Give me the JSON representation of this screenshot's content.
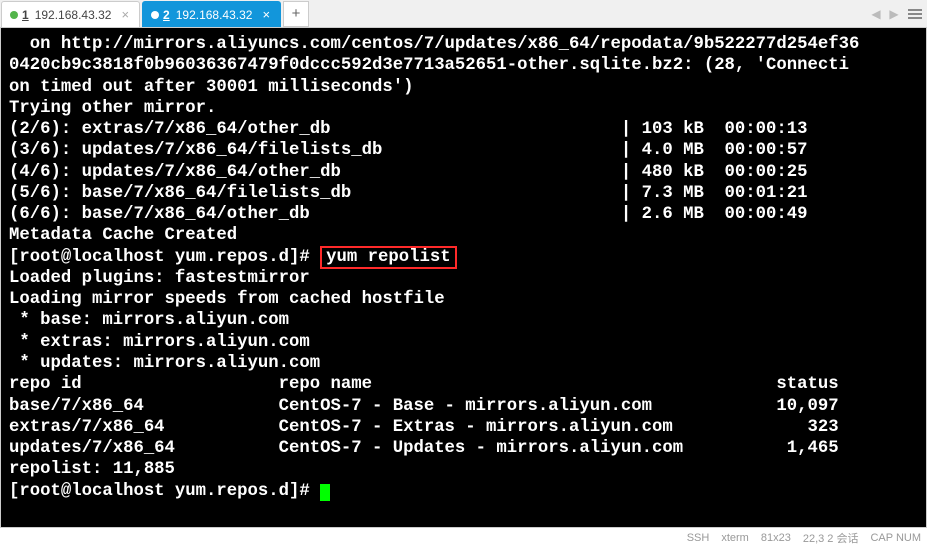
{
  "tabs": [
    {
      "num": "1",
      "label": "192.168.43.32",
      "active": false
    },
    {
      "num": "2",
      "label": "192.168.43.32",
      "active": true
    }
  ],
  "newtab_label": "+",
  "term": {
    "wrap1": "  on http://mirrors.aliyuncs.com/centos/7/updates/x86_64/repodata/9b522277d254ef36",
    "wrap2": "0420cb9c3818f0b96036367479f0dccc592d3e7713a52651-other.sqlite.bz2: (28, 'Connecti",
    "wrap3": "on timed out after 30001 milliseconds')",
    "trying": "Trying other mirror.",
    "row26": "(2/6): extras/7/x86_64/other_db                            | 103 kB  00:00:13",
    "row36": "(3/6): updates/7/x86_64/filelists_db                       | 4.0 MB  00:00:57",
    "row46": "(4/6): updates/7/x86_64/other_db                           | 480 kB  00:00:25",
    "row56": "(5/6): base/7/x86_64/filelists_db                          | 7.3 MB  00:01:21",
    "row66": "(6/6): base/7/x86_64/other_db                              | 2.6 MB  00:00:49",
    "metadata": "Metadata Cache Created",
    "prompt1": "[root@localhost yum.repos.d]# ",
    "cmd1": "yum repolist",
    "loaded": "Loaded plugins: fastestmirror",
    "loading": "Loading mirror speeds from cached hostfile",
    "base_mirror": " * base: mirrors.aliyun.com",
    "extras_mirror": " * extras: mirrors.aliyun.com",
    "updates_mirror": " * updates: mirrors.aliyun.com",
    "header": "repo id                   repo name                                       status",
    "line_base": "base/7/x86_64             CentOS-7 - Base - mirrors.aliyun.com            10,097",
    "line_extras": "extras/7/x86_64           CentOS-7 - Extras - mirrors.aliyun.com             323",
    "line_updates": "updates/7/x86_64          CentOS-7 - Updates - mirrors.aliyun.com          1,465",
    "repolist": "repolist: 11,885",
    "prompt2": "[root@localhost yum.repos.d]# "
  },
  "status": {
    "ssh": "SSH",
    "term_type": "xterm",
    "size": "81x23",
    "other": "22,3  2 会话",
    "caps": "CAP  NUM"
  }
}
